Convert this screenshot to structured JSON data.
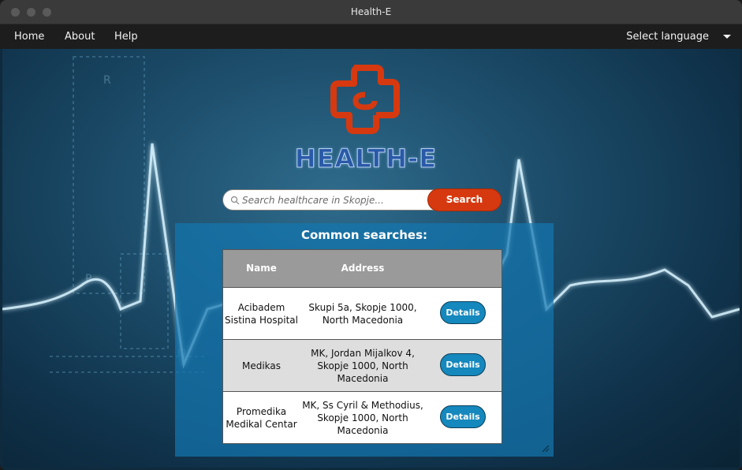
{
  "window": {
    "title": "Health-E"
  },
  "menu": {
    "home": "Home",
    "about": "About",
    "help": "Help",
    "language": "Select language"
  },
  "brand": {
    "name": "HEALTH-E",
    "colors": {
      "logo": "#d6390f",
      "text": "#2a59a7"
    }
  },
  "search": {
    "placeholder": "Search healthcare in Skopje...",
    "button_label": "Search"
  },
  "common": {
    "heading": "Common searches:",
    "columns": {
      "name": "Name",
      "address": "Address"
    },
    "rows": [
      {
        "name": "Acibadem Sistina Hospital",
        "address": "Skupi 5a, Skopje 1000, North Macedonia",
        "action": "Details"
      },
      {
        "name": "Medikas",
        "address": "MK, Jordan Mijalkov 4, Skopje 1000, North Macedonia",
        "action": "Details"
      },
      {
        "name": "Promedika Medikal Centar",
        "address": "MK, Ss Cyril & Methodius, Skopje 1000, North Macedonia",
        "action": "Details"
      }
    ]
  },
  "colors": {
    "accent": "#d6390f",
    "button": "#1588bd",
    "panel": "#1476af"
  }
}
